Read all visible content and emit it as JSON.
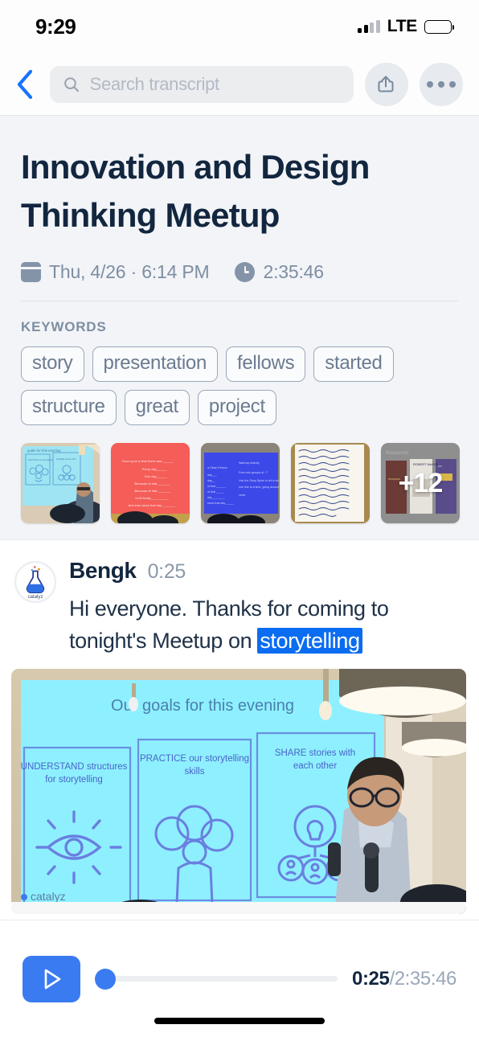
{
  "status_bar": {
    "time": "9:29",
    "carrier": "LTE",
    "signal_icon": "cellular-bars-icon",
    "battery_icon": "battery-full-icon"
  },
  "nav": {
    "back_icon": "chevron-left-icon",
    "search": {
      "icon": "search-icon",
      "value": "",
      "placeholder": "Search transcript"
    },
    "share_icon": "share-icon",
    "share_label": "Share",
    "more_icon": "ellipsis-icon",
    "more_label": "More options"
  },
  "header": {
    "title": "Innovation and Design Thinking Meetup",
    "calendar_icon": "calendar-icon",
    "date": "Thu, 4/26 · 6:14 PM",
    "clock_icon": "clock-icon",
    "duration": "2:35:46",
    "keywords_label": "KEYWORDS",
    "keywords": [
      "story",
      "presentation",
      "fellows",
      "started",
      "structure",
      "great",
      "project"
    ]
  },
  "thumbnails": [
    {
      "name": "thumbnail-goals-slide",
      "caption": "goals for this evening"
    },
    {
      "name": "thumbnail-story-spine-red",
      "caption": "Once upon a time there was"
    },
    {
      "name": "thumbnail-warmup-activity-blue",
      "caption": "Warmup Activity"
    },
    {
      "name": "thumbnail-handwritten-notes",
      "caption": "Handwritten story notes"
    },
    {
      "name": "thumbnail-resources-more",
      "caption": "Resources",
      "overflow_label": "+12"
    }
  ],
  "transcript": {
    "avatar_name": "catalyz",
    "speaker": "Bengk",
    "timestamp": "0:25",
    "text_before": "Hi everyone. Thanks for coming to tonight's Meetup on ",
    "highlight": "storytelling",
    "text_after": "",
    "media": {
      "name": "transcript-slide-photo",
      "slide_title": "Our goals for this evening",
      "panels": [
        "UNDERSTAND structures for storytelling",
        "PRACTICE our storytelling skills",
        "SHARE stories with each other"
      ],
      "watermark": "catalyz"
    }
  },
  "player": {
    "play_icon": "play-icon",
    "play_label": "Play",
    "current_time": "0:25",
    "separator": "/",
    "total_time": "2:35:46",
    "progress_percent": 0
  },
  "colors": {
    "accent": "#3b7bf2",
    "highlight": "#0a6cf0",
    "title": "#12263f",
    "muted": "#7e8ea3",
    "panel_bg": "#f2f4f7",
    "chip_border": "#9aa8bb"
  }
}
